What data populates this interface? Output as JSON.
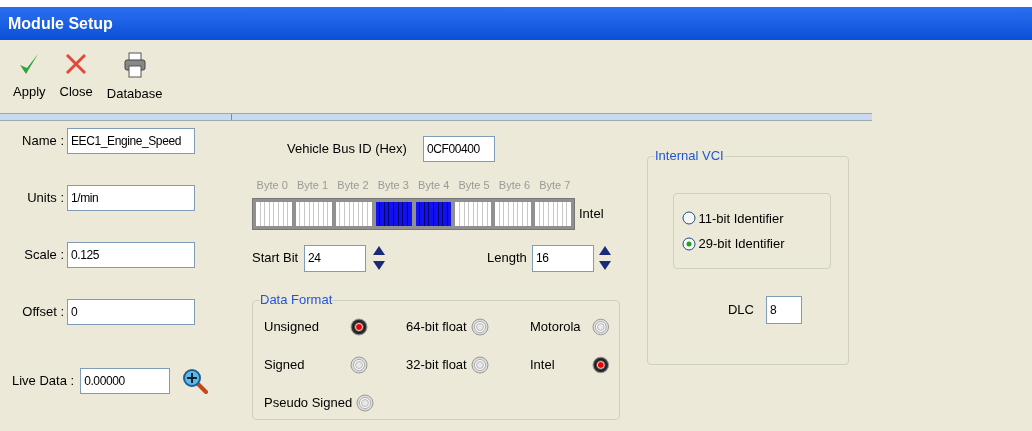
{
  "window": {
    "title": "Module Setup"
  },
  "toolbar": [
    {
      "kind": "apply",
      "label": "Apply"
    },
    {
      "kind": "close",
      "label": "Close"
    },
    {
      "kind": "database",
      "label": "Database"
    }
  ],
  "fields": [
    {
      "label": "Name :",
      "value": "EEC1_Engine_Speed"
    },
    {
      "label": "Units :",
      "value": "1/min"
    },
    {
      "label": "Scale :",
      "value": "0.125"
    },
    {
      "label": "Offset :",
      "value": "0"
    }
  ],
  "live_data": {
    "label": "Live Data :",
    "value": "0.00000"
  },
  "bus_id": {
    "label": "Vehicle Bus ID (Hex)",
    "value": "0CF00400"
  },
  "bit_map": {
    "order_label": "Intel",
    "bytes": [
      {
        "label": "Byte 0",
        "selected": false
      },
      {
        "label": "Byte 1",
        "selected": false
      },
      {
        "label": "Byte 2",
        "selected": false
      },
      {
        "label": "Byte 3",
        "selected": true
      },
      {
        "label": "Byte 4",
        "selected": true
      },
      {
        "label": "Byte 5",
        "selected": false
      },
      {
        "label": "Byte 6",
        "selected": false
      },
      {
        "label": "Byte 7",
        "selected": false
      }
    ]
  },
  "start_bit": {
    "label": "Start Bit",
    "value": "24"
  },
  "length": {
    "label": "Length",
    "value": "16"
  },
  "data_format": {
    "title": "Data Format",
    "columns": [
      [
        {
          "label": "Unsigned",
          "selected": true
        },
        {
          "label": "Signed",
          "selected": false
        },
        {
          "label": "Pseudo Signed",
          "selected": false
        }
      ],
      [
        {
          "label": "64-bit float",
          "selected": false
        },
        {
          "label": "32-bit float",
          "selected": false
        }
      ],
      [
        {
          "label": "Motorola",
          "selected": false
        },
        {
          "label": "Intel",
          "selected": true
        }
      ]
    ]
  },
  "internal_vci": {
    "title": "Internal VCI",
    "identifiers": [
      {
        "label": "11-bit Identifier",
        "selected": false
      },
      {
        "label": "29-bit Identifier",
        "selected": true
      }
    ],
    "dlc": {
      "label": "DLC",
      "value": "8"
    }
  }
}
